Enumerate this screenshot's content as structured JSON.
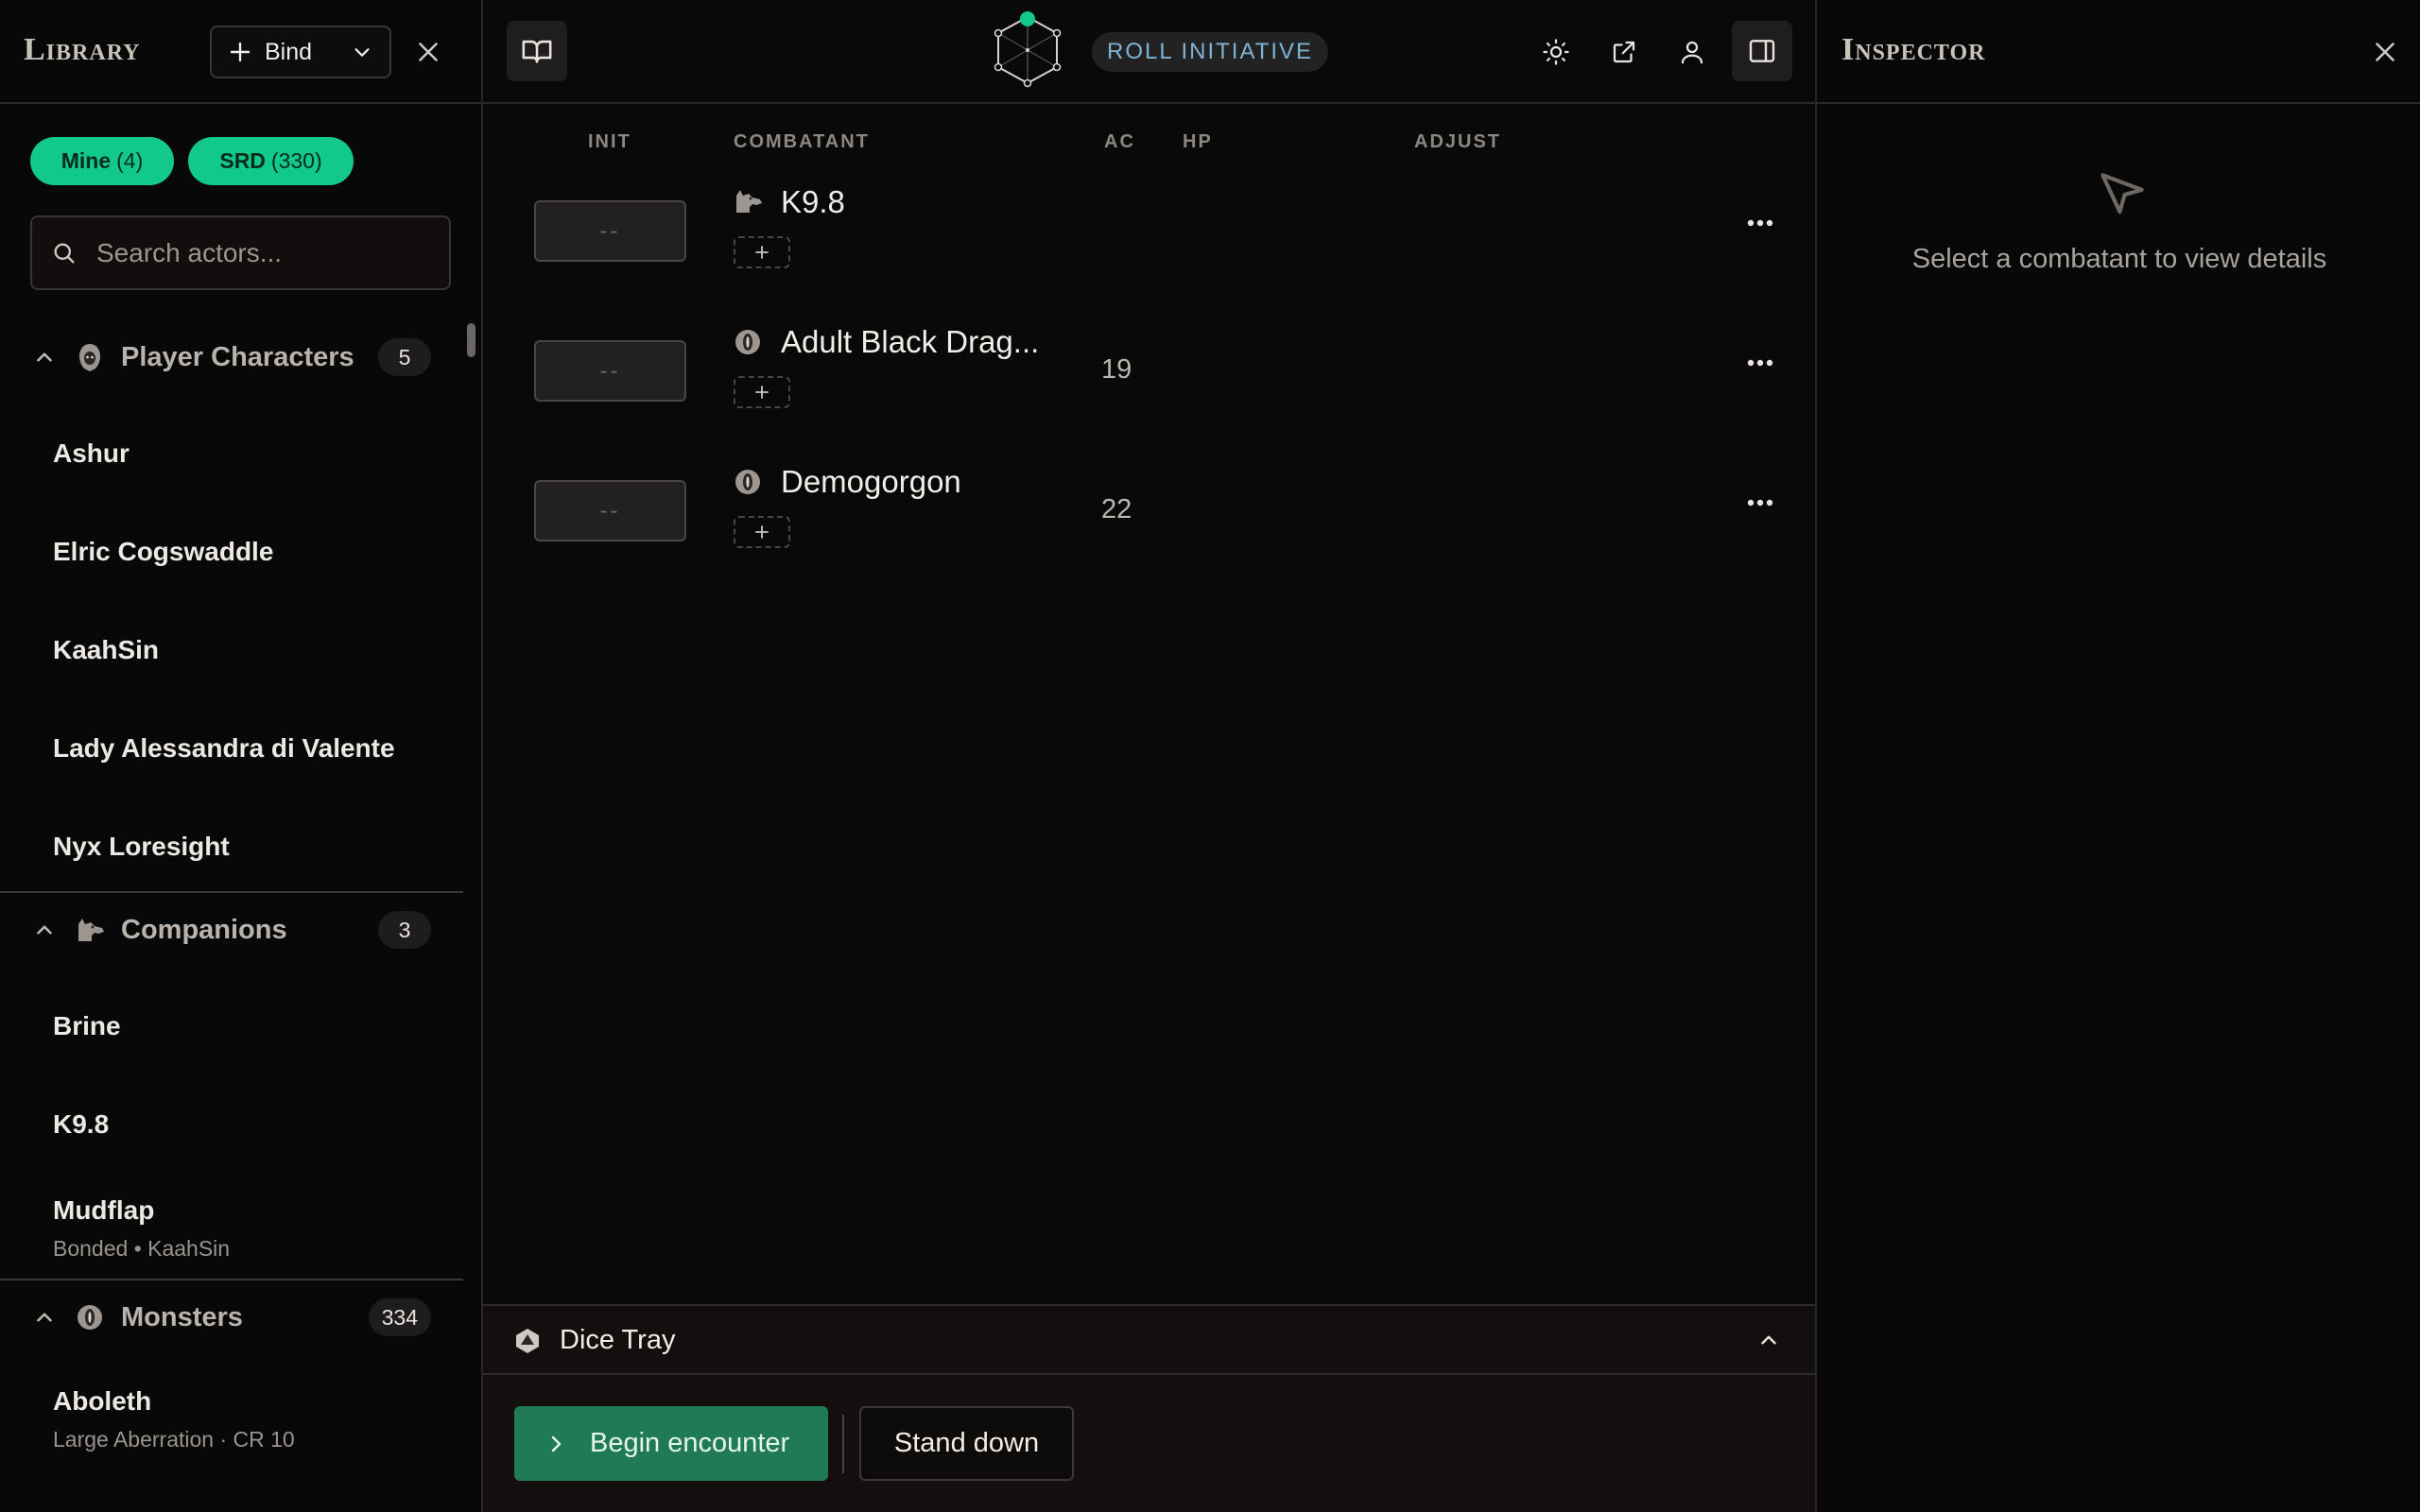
{
  "library": {
    "title": "Library",
    "bind_label": "Bind",
    "filters": [
      {
        "label": "Mine",
        "count": "(4)"
      },
      {
        "label": "SRD",
        "count": "(330)"
      }
    ],
    "search_placeholder": "Search actors...",
    "groups": {
      "players": {
        "name": "Player Characters",
        "count": "5",
        "items": [
          "Ashur",
          "Elric Cogswaddle",
          "KaahSin",
          "Lady Alessandra di Valente",
          "Nyx Loresight"
        ]
      },
      "companions": {
        "name": "Companions",
        "count": "3",
        "items": [
          "Brine",
          "K9.8",
          "Mudflap"
        ],
        "mudflap_sub": "Bonded • KaahSin"
      },
      "monsters": {
        "name": "Monsters",
        "count": "334",
        "items": [
          "Aboleth"
        ],
        "aboleth_sub": "Large Aberration · CR 10"
      }
    }
  },
  "main": {
    "badge": "ROLL INITIATIVE",
    "columns": {
      "init": "INIT",
      "combatant": "COMBATANT",
      "ac": "AC",
      "hp": "HP",
      "adjust": "ADJUST"
    },
    "combatants": [
      {
        "init": "--",
        "name": "K9.8",
        "ac": "",
        "icon": "companion-icon"
      },
      {
        "init": "--",
        "name": "Adult Black Drag...",
        "ac": "19",
        "icon": "monster-icon"
      },
      {
        "init": "--",
        "name": "Demogorgon",
        "ac": "22",
        "icon": "monster-icon"
      }
    ],
    "dice_tray": "Dice Tray",
    "begin_label": "Begin encounter",
    "stand_label": "Stand down"
  },
  "inspector": {
    "title": "Inspector",
    "empty_text": "Select a combatant to view details"
  },
  "colors": {
    "accent_green": "#10c98a",
    "begin_green": "#1f7a55",
    "badge_blue": "#7fb3d6",
    "background": "#0a0909"
  }
}
